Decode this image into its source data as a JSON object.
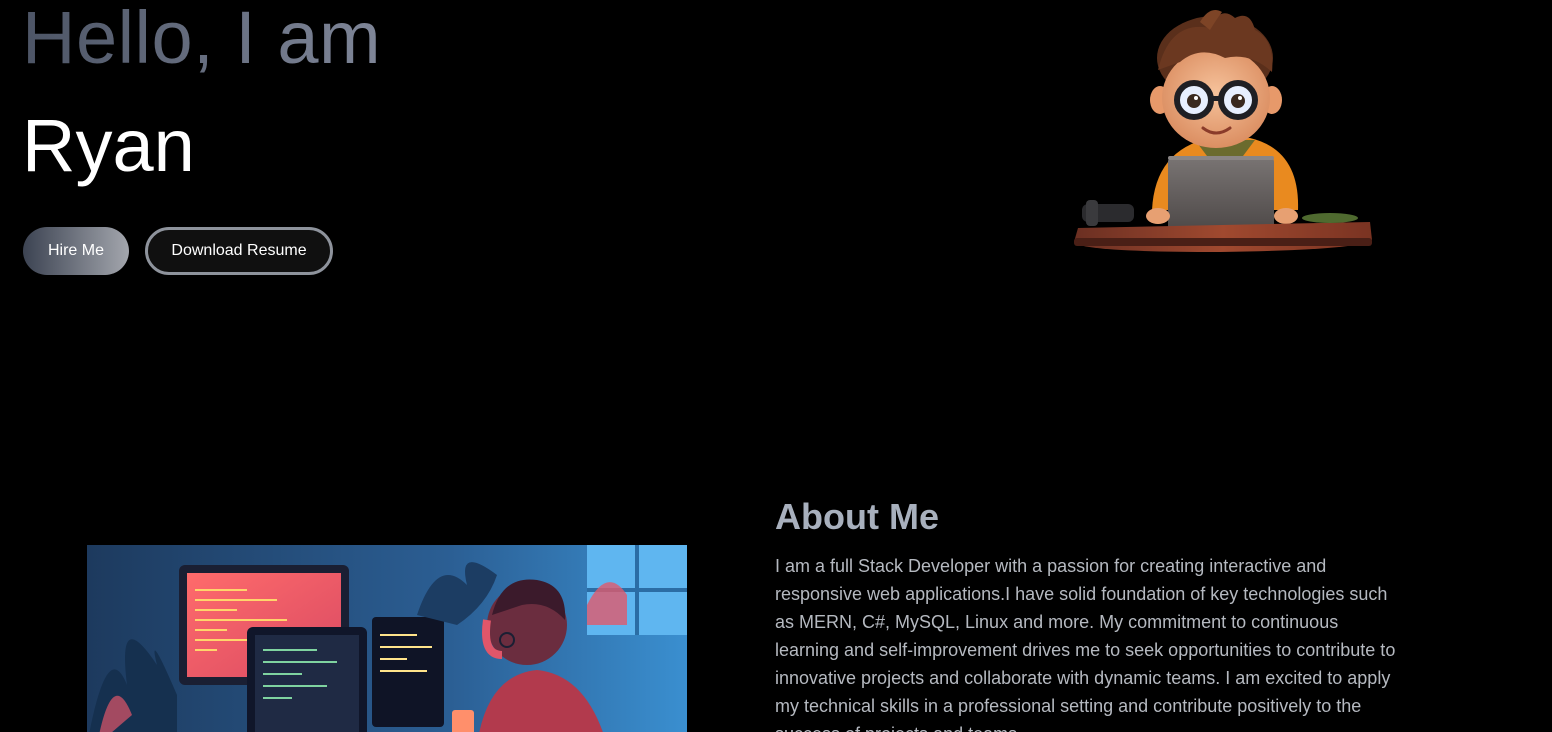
{
  "hero": {
    "greeting": "Hello, I am",
    "name": "Ryan",
    "hire_label": "Hire Me",
    "resume_label": "Download Resume"
  },
  "about": {
    "title": "About Me",
    "paragraph": "I am a full Stack Developer with a passion for creating interactive and responsive web applications.I have solid foundation of key technologies such as MERN, C#, MySQL, Linux and more. My commitment to continuous learning and self-improvement drives me to seek opportunities to contribute to innovative projects and collaborate with dynamic teams. I am excited to apply my technical skills in a professional setting and contribute positively to the success of projects and teams."
  },
  "icons": {
    "avatar": "cartoon-developer-avatar",
    "about_image": "developer-coding-illustration"
  },
  "colors": {
    "background": "#000000",
    "greeting_gradient_start": "#4d5566",
    "greeting_gradient_end": "#7f8698",
    "button_border": "#8e939c",
    "about_title": "#a8b0bd",
    "about_text": "#b5b9c0"
  }
}
